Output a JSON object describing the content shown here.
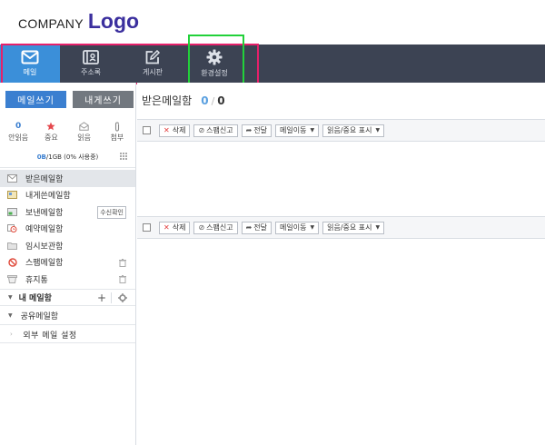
{
  "header": {
    "company": "COMPANY",
    "logo": "Logo"
  },
  "nav": [
    {
      "label": "메일",
      "icon": "mail-icon",
      "active": true
    },
    {
      "label": "주소록",
      "icon": "address-book-icon"
    },
    {
      "label": "게시판",
      "icon": "edit-icon"
    },
    {
      "label": "환경설정",
      "icon": "gear-icon"
    }
  ],
  "compose": {
    "write": "메일쓰기",
    "to_me": "내게쓰기"
  },
  "stats": [
    {
      "value": "0",
      "label": "안읽음",
      "icon": ""
    },
    {
      "label": "중요",
      "icon": "star-icon"
    },
    {
      "label": "읽음",
      "icon": "envelope-open-icon"
    },
    {
      "label": "첨부",
      "icon": "paperclip-icon"
    }
  ],
  "quota": {
    "used": "0B",
    "rest": " /1GB (0% 사용중)"
  },
  "folders": [
    {
      "label": "받은메일함",
      "icon": "inbox-icon",
      "selected": true
    },
    {
      "label": "내게쓴메일함",
      "icon": "self-mail-icon"
    },
    {
      "label": "보낸메일함",
      "icon": "sent-icon",
      "tag": "수신확인"
    },
    {
      "label": "예약메일함",
      "icon": "clock-icon"
    },
    {
      "label": "임시보관함",
      "icon": "draft-folder-icon"
    },
    {
      "label": "스팸메일함",
      "icon": "ban-icon",
      "trash": true
    },
    {
      "label": "휴지통",
      "icon": "trash-icon",
      "trash": true
    }
  ],
  "mybox": {
    "label": "내 메일함",
    "plus": "+"
  },
  "sharebox": {
    "label": "공유메일함"
  },
  "external": {
    "label": "외부 메일 설정"
  },
  "inbox": {
    "title": "받은메일함",
    "unread": "0",
    "separator": "/",
    "total": "0"
  },
  "toolbar": {
    "delete": "삭제",
    "spam": "스팸신고",
    "forward": "전달",
    "move": "메일이동",
    "mark": "읽음/중요 표시"
  },
  "colors": {
    "accent": "#3b7fd0",
    "nav_bg": "#3c4353",
    "nav_active": "#3b8fd9"
  }
}
